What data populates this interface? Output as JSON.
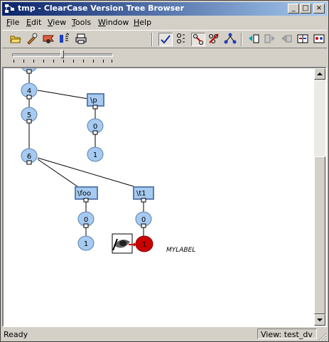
{
  "window": {
    "title": "tmp - ClearCase Version Tree Browser"
  },
  "title_buttons": {
    "minimize": "_",
    "maximize": "□",
    "close": "×"
  },
  "menu": {
    "items": [
      {
        "label": "File",
        "mnemonic": "F",
        "rest": "ile"
      },
      {
        "label": "Edit",
        "mnemonic": "E",
        "rest": "dit"
      },
      {
        "label": "View",
        "mnemonic": "V",
        "rest": "iew"
      },
      {
        "label": "Tools",
        "mnemonic": "T",
        "rest": "ools"
      },
      {
        "label": "Window",
        "mnemonic": "W",
        "rest": "indow"
      },
      {
        "label": "Help",
        "mnemonic": "H",
        "rest": "elp"
      }
    ]
  },
  "toolbar": {
    "buttons": [
      {
        "name": "open-folder-icon"
      },
      {
        "name": "properties-icon"
      },
      {
        "name": "browse-icon"
      },
      {
        "name": "compare-icon"
      },
      {
        "name": "print-icon"
      },
      {
        "name": "check-icon",
        "pressed": true
      },
      {
        "name": "versions-icon"
      },
      {
        "name": "merge-arrows-icon",
        "pressed": true
      },
      {
        "name": "hide-icon"
      },
      {
        "name": "tree-icon"
      },
      {
        "name": "nav-back-icon"
      },
      {
        "name": "nav-forward-icon"
      },
      {
        "name": "nav-disabled-icon"
      },
      {
        "name": "diff-icon"
      },
      {
        "name": "diff-alt-icon"
      }
    ]
  },
  "zoom_slider": {
    "value": 0.5
  },
  "tree": {
    "versions_main": [
      "4",
      "5",
      "6"
    ],
    "branches": [
      {
        "name": "\\p",
        "versions": [
          "0",
          "1"
        ]
      },
      {
        "name": "\\foo",
        "versions": [
          "0",
          "1"
        ]
      },
      {
        "name": "\\t1",
        "versions": [
          "0",
          "1"
        ]
      }
    ],
    "label": "MYLABEL",
    "colors": {
      "node_fill": "#a6caf0",
      "node_stroke": "#5a7fb0",
      "checkedout": "#cc0000"
    }
  },
  "status": {
    "left": "Ready",
    "view_label": "View:",
    "view_value": "test_dv"
  }
}
